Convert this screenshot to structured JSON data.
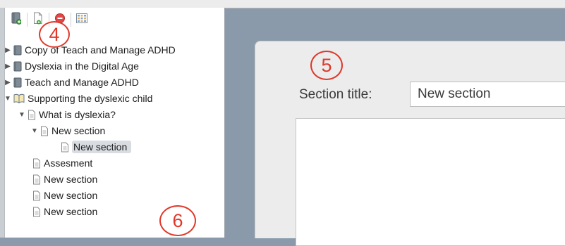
{
  "toolbar": {
    "buttons": [
      {
        "name": "new-book",
        "icon": "book-add-icon"
      },
      {
        "name": "new-page",
        "icon": "page-add-icon"
      },
      {
        "name": "delete",
        "icon": "delete-icon"
      },
      {
        "name": "grid",
        "icon": "grid-icon"
      }
    ]
  },
  "tree": {
    "items": [
      {
        "label": "Copy of Teach and Manage ADHD",
        "type": "book",
        "expanded": false
      },
      {
        "label": "Dyslexia in the Digital Age",
        "type": "book",
        "expanded": false
      },
      {
        "label": "Teach and Manage ADHD",
        "type": "book",
        "expanded": false
      },
      {
        "label": "Supporting the dyslexic child",
        "type": "open-book",
        "expanded": true
      },
      {
        "label": "What is dyslexia?",
        "type": "page",
        "expanded": true
      },
      {
        "label": "New section",
        "type": "page",
        "expanded": true
      },
      {
        "label": "New section",
        "type": "page",
        "selected": true
      },
      {
        "label": "Assesment",
        "type": "page"
      },
      {
        "label": "New section",
        "type": "page"
      },
      {
        "label": "New section",
        "type": "page"
      },
      {
        "label": "New section",
        "type": "page"
      }
    ]
  },
  "main": {
    "section_title_label": "Section title:",
    "section_title_value": "New section"
  },
  "callouts": [
    "4",
    "5",
    "6"
  ],
  "colors": {
    "accent": "#e0382b",
    "selection": "#d9dce1",
    "background": "#8a9aaa"
  }
}
